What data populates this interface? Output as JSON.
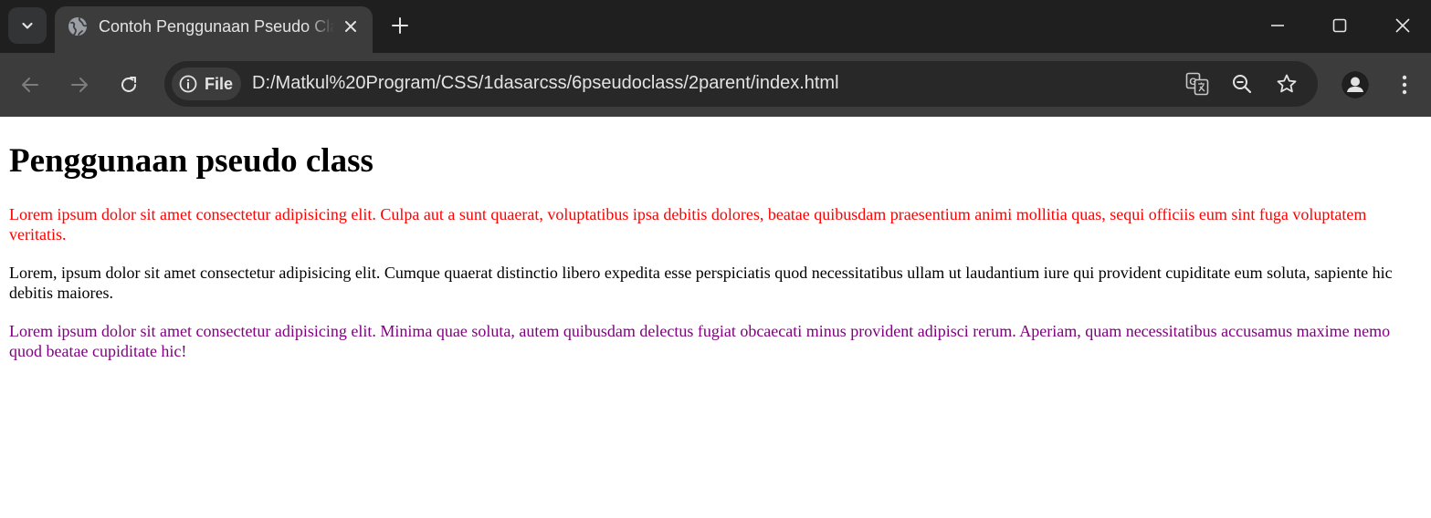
{
  "browser": {
    "tab": {
      "title": "Contoh Penggunaan Pseudo Class",
      "icon": "globe-icon"
    },
    "address": {
      "chip_label": "File",
      "url": "D:/Matkul%20Program/CSS/1dasarcss/6pseudoclass/2parent/index.html"
    },
    "colors": {
      "frame": "#1f1f1f",
      "toolbar": "#3c3c3c",
      "omnibox": "#282828",
      "text": "#e3e3e3"
    }
  },
  "page": {
    "heading": "Penggunaan pseudo class",
    "paragraphs": [
      {
        "text": "Lorem ipsum dolor sit amet consectetur adipisicing elit. Culpa aut a sunt quaerat, voluptatibus ipsa debitis dolores, beatae quibusdam praesentium animi mollitia quas, sequi officiis eum sint fuga voluptatem veritatis.",
        "color": "#ff0000"
      },
      {
        "text": "Lorem, ipsum dolor sit amet consectetur adipisicing elit. Cumque quaerat distinctio libero expedita esse perspiciatis quod necessitatibus ullam ut laudantium iure qui provident cupiditate eum soluta, sapiente hic debitis maiores.",
        "color": "#000000"
      },
      {
        "text": "Lorem ipsum dolor sit amet consectetur adipisicing elit. Minima quae soluta, autem quibusdam delectus fugiat obcaecati minus provident adipisci rerum. Aperiam, quam necessitatibus accusamus maxime nemo quod beatae cupiditate hic!",
        "color": "#800080"
      }
    ]
  }
}
